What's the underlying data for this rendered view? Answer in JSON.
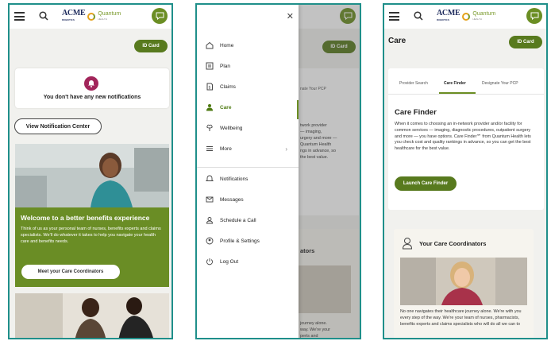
{
  "brand": {
    "acme": "ACME",
    "acme_sub": "ROBOTICS",
    "qh": "Quantum",
    "qh_sub": "HEALTH"
  },
  "colors": {
    "accent": "#6b8e23",
    "frame": "#1f8f8a",
    "bell": "#a2255a"
  },
  "screen1": {
    "id_card": "ID Card",
    "notification_text": "You don't have any new notifications",
    "view_notification_center": "View Notification Center",
    "promo_title": "Welcome to a better benefits experience",
    "promo_body": "Think of us as your personal team of nurses, benefits experts and claims specialists. We'll do whatever it takes to help you navigate your health care and benefits needs.",
    "promo_button": "Meet your Care Coordinators"
  },
  "screen2": {
    "id_card": "ID Card",
    "bg_heading": "nate Your PCP",
    "bg_text": "twork provider\n— imaging,\nurgery and more —\n Quantum Health\nngs in advance, so\nthe best value.",
    "bg_heading2": "ators",
    "bg_text2": "journey alone.\nway. We're your\nperts and",
    "menu": [
      {
        "label": "Home",
        "icon": "home-icon"
      },
      {
        "label": "Plan",
        "icon": "plan-icon"
      },
      {
        "label": "Claims",
        "icon": "claims-icon"
      },
      {
        "label": "Care",
        "icon": "care-icon"
      },
      {
        "label": "Wellbeing",
        "icon": "wellbeing-icon"
      },
      {
        "label": "More",
        "icon": "more-icon"
      },
      {
        "label": "Notifications",
        "icon": "bell-icon"
      },
      {
        "label": "Messages",
        "icon": "envelope-icon"
      },
      {
        "label": "Schedule a Call",
        "icon": "phone-person-icon"
      },
      {
        "label": "Profile & Settings",
        "icon": "profile-icon"
      },
      {
        "label": "Log Out",
        "icon": "power-icon"
      }
    ],
    "active_item": "Care"
  },
  "screen3": {
    "page_title": "Care",
    "id_card": "ID Card",
    "tabs": [
      "Provider Search",
      "Care Finder",
      "Designate Your PCP"
    ],
    "active_tab": "Care Finder",
    "care_finder_title": "Care Finder",
    "care_finder_body": "When it comes to choosing an in-network provider and/or facility for common services — imaging, diagnostic procedures, outpatient surgery and more — you have options. Care Finder℠ from Quantum Health lets you check cost and quality rankings in advance, so you can get the best healthcare for the best value.",
    "launch_button": "Launch Care Finder",
    "coord_title": "Your Care Coordinators",
    "coord_body": "No one navigates their healthcare journey alone. We're with you every step of the way. We're your team of nurses, pharmacists, benefits experts and claims specialists who will do all we can to"
  }
}
